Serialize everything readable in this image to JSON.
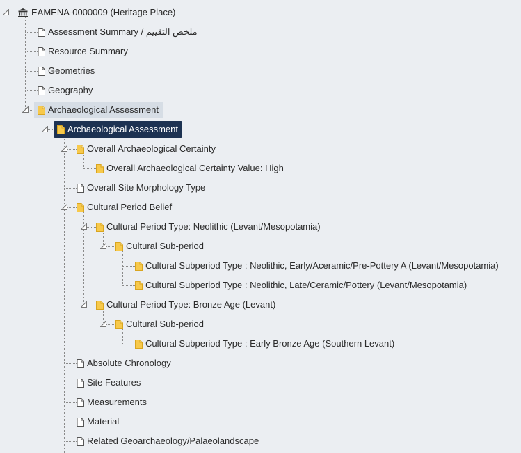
{
  "colors": {
    "background": "#ebeef2",
    "selected_bg": "#1d3252",
    "hover_bg": "#d6dde5",
    "folder_icon": "#f7c94b",
    "line": "#8a8a8a"
  },
  "tree": [
    {
      "name": "tree-root",
      "label": "EAMENA-0000009 (Heritage Place)",
      "icon": "institution-icon",
      "level": 0,
      "state": "open",
      "style": ""
    },
    {
      "name": "tree-item-assessment-summary",
      "label": "Assessment Summary / ملخص التقييم",
      "icon": "file-icon",
      "level": 1,
      "state": "leaf",
      "style": ""
    },
    {
      "name": "tree-item-resource-summary",
      "label": "Resource Summary",
      "icon": "file-icon",
      "level": 1,
      "state": "leaf",
      "style": ""
    },
    {
      "name": "tree-item-geometries",
      "label": "Geometries",
      "icon": "file-icon",
      "level": 1,
      "state": "leaf",
      "style": ""
    },
    {
      "name": "tree-item-geography",
      "label": "Geography",
      "icon": "file-icon",
      "level": 1,
      "state": "leaf",
      "style": ""
    },
    {
      "name": "tree-item-archaeological-assessment",
      "label": "Archaeological Assessment",
      "icon": "folder-file-icon",
      "level": 1,
      "state": "open",
      "style": "hover"
    },
    {
      "name": "tree-item-archaeological-assessment-card",
      "label": "Archaeological Assessment",
      "icon": "folder-file-icon",
      "level": 2,
      "state": "open",
      "style": "selected"
    },
    {
      "name": "tree-item-overall-archaeological-certainty",
      "label": "Overall Archaeological Certainty",
      "icon": "folder-file-icon",
      "level": 3,
      "state": "open",
      "style": ""
    },
    {
      "name": "tree-item-overall-archaeological-certainty-value",
      "label": "Overall Archaeological Certainty Value: High",
      "icon": "folder-file-icon",
      "level": 4,
      "state": "leaf",
      "style": ""
    },
    {
      "name": "tree-item-overall-site-morphology-type",
      "label": "Overall Site Morphology Type",
      "icon": "file-icon",
      "level": 3,
      "state": "leaf",
      "style": ""
    },
    {
      "name": "tree-item-cultural-period-belief",
      "label": "Cultural Period Belief",
      "icon": "folder-file-icon",
      "level": 3,
      "state": "open",
      "style": ""
    },
    {
      "name": "tree-item-cultural-period-neolithic",
      "label": "Cultural Period Type: Neolithic (Levant/Mesopotamia)",
      "icon": "folder-file-icon",
      "level": 4,
      "state": "open",
      "style": ""
    },
    {
      "name": "tree-item-cultural-sub-period-1",
      "label": "Cultural Sub-period",
      "icon": "folder-file-icon",
      "level": 5,
      "state": "open",
      "style": ""
    },
    {
      "name": "tree-item-subperiod-neolithic-early",
      "label": "Cultural Subperiod Type : Neolithic, Early/Aceramic/Pre-Pottery A (Levant/Mesopotamia)",
      "icon": "folder-file-icon",
      "level": 6,
      "state": "leaf",
      "style": ""
    },
    {
      "name": "tree-item-subperiod-neolithic-late",
      "label": "Cultural Subperiod Type : Neolithic, Late/Ceramic/Pottery (Levant/Mesopotamia)",
      "icon": "folder-file-icon",
      "level": 6,
      "state": "leaf",
      "style": ""
    },
    {
      "name": "tree-item-cultural-period-bronze-age",
      "label": "Cultural Period Type: Bronze Age (Levant)",
      "icon": "folder-file-icon",
      "level": 4,
      "state": "open",
      "style": ""
    },
    {
      "name": "tree-item-cultural-sub-period-2",
      "label": "Cultural Sub-period",
      "icon": "folder-file-icon",
      "level": 5,
      "state": "open",
      "style": ""
    },
    {
      "name": "tree-item-subperiod-early-bronze-age",
      "label": "Cultural Subperiod Type : Early Bronze Age (Southern Levant)",
      "icon": "folder-file-icon",
      "level": 6,
      "state": "leaf",
      "style": ""
    },
    {
      "name": "tree-item-absolute-chronology",
      "label": "Absolute Chronology",
      "icon": "file-icon",
      "level": 3,
      "state": "leaf",
      "style": ""
    },
    {
      "name": "tree-item-site-features",
      "label": "Site Features",
      "icon": "file-icon",
      "level": 3,
      "state": "leaf",
      "style": ""
    },
    {
      "name": "tree-item-measurements",
      "label": "Measurements",
      "icon": "file-icon",
      "level": 3,
      "state": "leaf",
      "style": ""
    },
    {
      "name": "tree-item-material",
      "label": "Material",
      "icon": "file-icon",
      "level": 3,
      "state": "leaf",
      "style": ""
    },
    {
      "name": "tree-item-related-geoarchaeology",
      "label": "Related Geoarchaeology/Palaeolandscape",
      "icon": "file-icon",
      "level": 3,
      "state": "leaf",
      "style": ""
    }
  ]
}
